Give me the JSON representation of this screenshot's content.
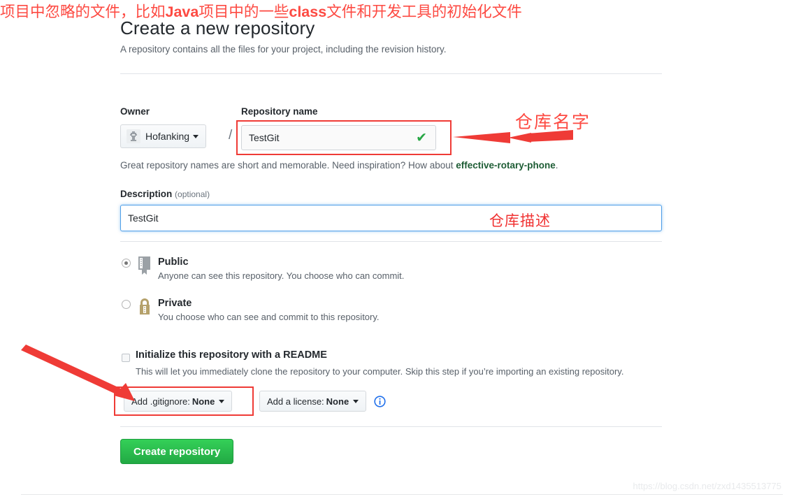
{
  "header": {
    "title": "Create a new repository",
    "subtitle": "A repository contains all the files for your project, including the revision history."
  },
  "owner": {
    "label": "Owner",
    "name": "Hofanking",
    "separator": "/"
  },
  "repository_name": {
    "label": "Repository name",
    "value": "TestGit",
    "valid_check": "✔"
  },
  "name_hint": {
    "prefix": "Great repository names are short and memorable. Need inspiration? How about ",
    "suggestion": "effective-rotary-phone",
    "suffix": "."
  },
  "description": {
    "label": "Description",
    "optional": "(optional)",
    "value": "TestGit"
  },
  "visibility": {
    "public": {
      "title": "Public",
      "description": "Anyone can see this repository. You choose who can commit.",
      "selected": true
    },
    "private": {
      "title": "Private",
      "description": "You choose who can see and commit to this repository.",
      "selected": false
    }
  },
  "readme": {
    "title": "Initialize this repository with a README",
    "description": "This will let you immediately clone the repository to your computer. Skip this step if you’re importing an existing repository.",
    "checked": false
  },
  "gitignore": {
    "prefix": "Add .gitignore:",
    "value": "None"
  },
  "license": {
    "prefix": "Add a license:",
    "value": "None"
  },
  "create_button": {
    "label": "Create repository"
  },
  "annotations": {
    "repo_name_note": "仓库名字",
    "description_note": "仓库描述",
    "gitignore_note_1": "项目中忽略的文件，比如",
    "gitignore_note_java": "Java",
    "gitignore_note_2": "项目中的一些",
    "gitignore_note_class": "class",
    "gitignore_note_3": "文件和开发工具的初始化文件"
  },
  "watermark": {
    "text": "https://blog.csdn.net/zxd1435513775"
  },
  "colors": {
    "annotation_red": "#fd4a42",
    "box_red": "#ef3b36",
    "create_green": "#28a745",
    "focus_blue": "#4f9fe8",
    "link_green": "#1d5c34",
    "private_gold": "#b5a16b"
  }
}
